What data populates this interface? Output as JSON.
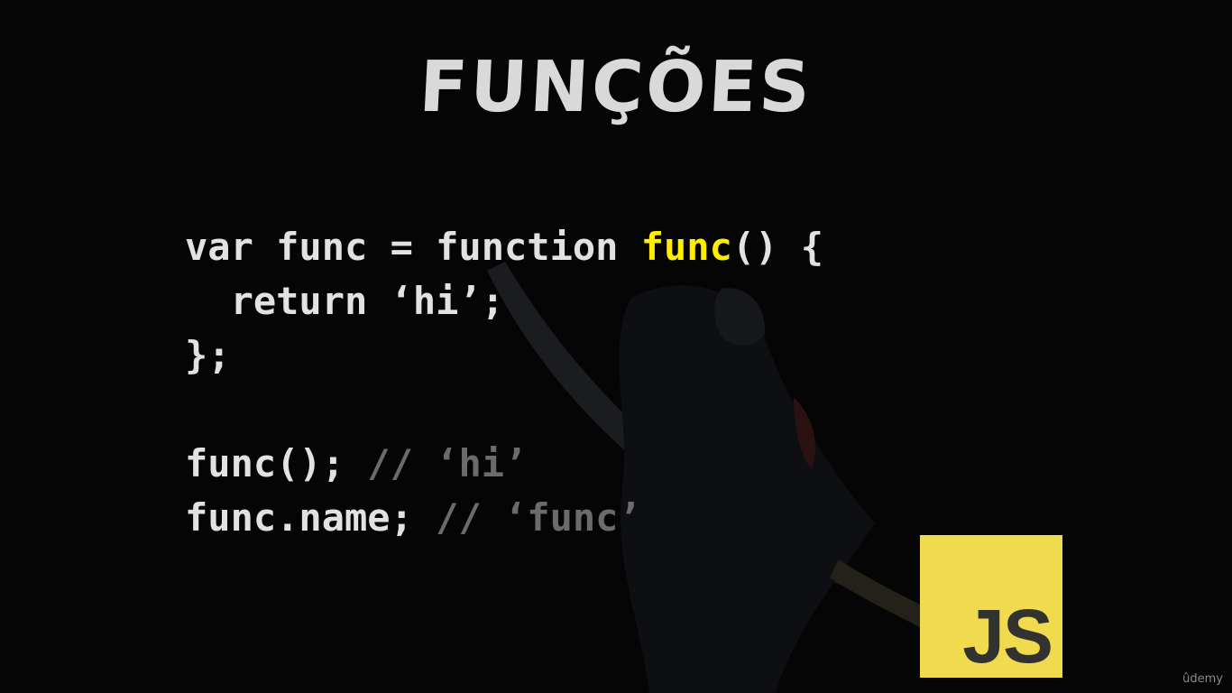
{
  "slide": {
    "title": "Funções",
    "code": {
      "line1": {
        "kw": "var func = function ",
        "name": "func",
        "rest": "() {"
      },
      "line2": "  return ‘hi’;",
      "line3": "};",
      "line5": {
        "code": "func(); ",
        "comment": "// ‘hi’"
      },
      "line6": {
        "code": "func.name; ",
        "comment": "// ‘func’"
      }
    },
    "logo_text": "JS",
    "watermark": "ûdemy"
  },
  "colors": {
    "background": "#050505",
    "title": "#d9d9d9",
    "code": "#e2e2e2",
    "highlight": "#ffed00",
    "comment": "#6b6b6b",
    "js_logo": "#f0db4f"
  },
  "icons": {
    "logo": "javascript-logo"
  }
}
